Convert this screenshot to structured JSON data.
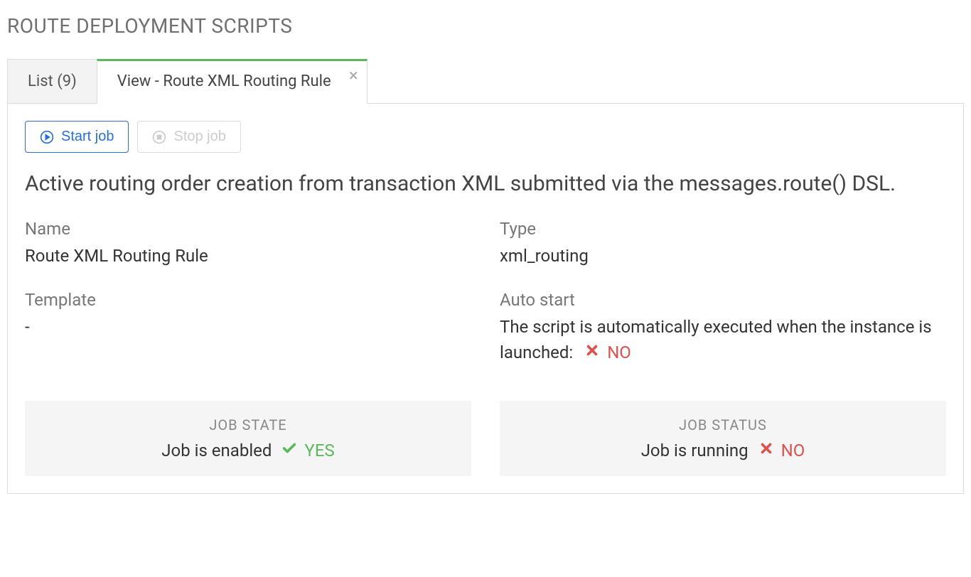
{
  "page": {
    "title": "ROUTE DEPLOYMENT SCRIPTS"
  },
  "tabs": {
    "list": "List (9)",
    "view": "View - Route XML Routing Rule"
  },
  "toolbar": {
    "start": "Start job",
    "stop": "Stop job"
  },
  "description": "Active routing order creation from transaction XML submitted via the messages.route() DSL.",
  "fields": {
    "name_label": "Name",
    "name_value": "Route XML Routing Rule",
    "type_label": "Type",
    "type_value": "xml_routing",
    "template_label": "Template",
    "template_value": "-",
    "autostart_label": "Auto start",
    "autostart_text": "The script is automatically executed when the instance is launched:",
    "autostart_status": "NO"
  },
  "status": {
    "state_title": "JOB STATE",
    "state_text": "Job is enabled",
    "state_value": "YES",
    "status_title": "JOB STATUS",
    "status_text": "Job is running",
    "status_value": "NO"
  }
}
